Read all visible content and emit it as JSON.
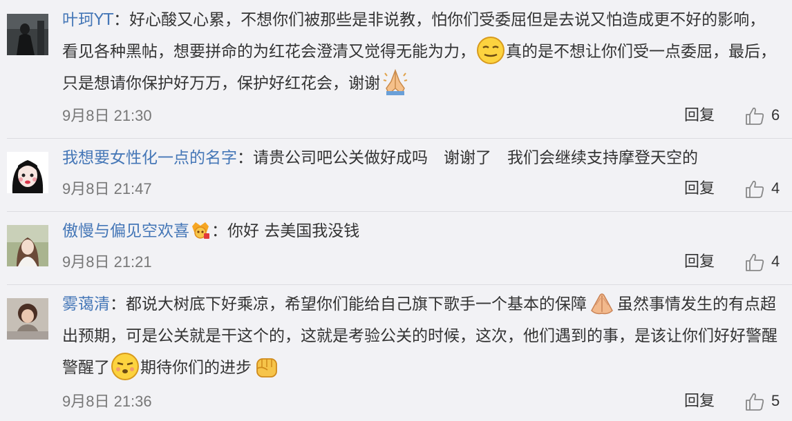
{
  "comments": [
    {
      "username": "叶珂YT",
      "separator": "：",
      "text_1": "好心酸又心累，不想你们被那些是非说教，怕你们受委屈但是去说又怕造成更不好的影响，看见各种黑帖，想要拼命的为红花会澄清又觉得无能为力，",
      "emoji_1": "smile-emoji",
      "text_2": "真的是不想让你们受一点委屈，最后，只是想请你保护好万万，保护好红花会，谢谢",
      "emoji_2": "pray-emoji",
      "time": "9月8日 21:30",
      "reply_label": "回复",
      "likes": "6"
    },
    {
      "username": "我想要女性化一点的名字",
      "separator": "：",
      "text_1": "请贵公司吧公关做好成吗　谢谢了　我们会继续支持摩登天空的",
      "time": "9月8日 21:47",
      "reply_label": "回复",
      "likes": "4"
    },
    {
      "username": "傲慢与偏见空欢喜",
      "badge": "member-badge-icon",
      "separator": "：",
      "text_1": "你好  去美国我没钱",
      "time": "9月8日 21:21",
      "reply_label": "回复",
      "likes": "4"
    },
    {
      "username": "雾蔼清",
      "separator": "：",
      "text_1": "都说大树底下好乘凉，希望你们能给自己旗下歌手一个基本的保障",
      "emoji_1": "clap-emoji",
      "text_2": "虽然事情发生的有点超出预期，可是公关就是干这个的，这就是考验公关的时候，这次，他们遇到的事，是该让你们好好警醒警醒了",
      "emoji_2": "pout-emoji",
      "text_3": "期待你们的进步",
      "emoji_3": "fist-emoji",
      "time": "9月8日 21:36",
      "reply_label": "回复",
      "likes": "5"
    }
  ],
  "colors": {
    "background": "#f2f2f5",
    "username": "#4577b7",
    "text": "#333333",
    "time": "#777777",
    "divider": "#dcdce0"
  }
}
